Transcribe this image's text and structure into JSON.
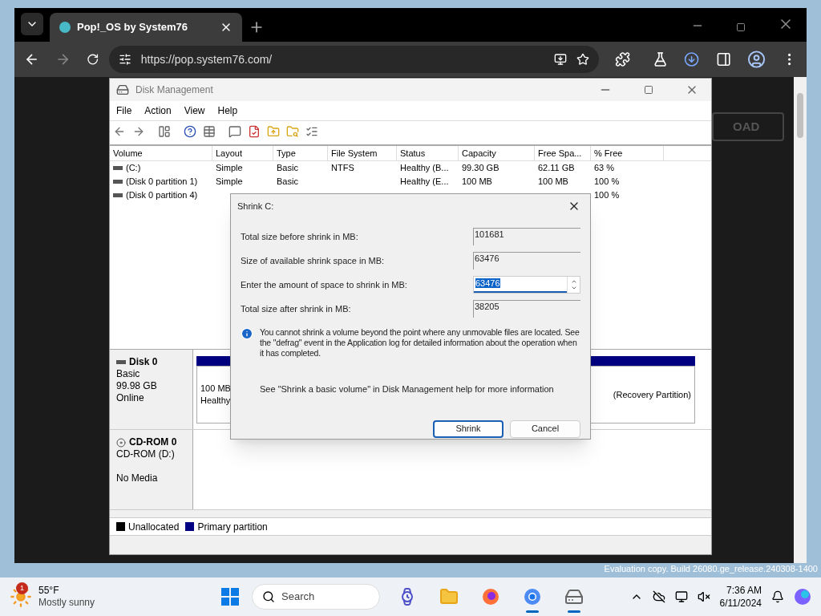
{
  "browser": {
    "tab": {
      "title": "Pop!_OS by System76",
      "selected": true
    },
    "url": "https://pop.system76.com/",
    "page_button": "OAD"
  },
  "disk_management": {
    "title": "Disk Management",
    "menu": [
      "File",
      "Action",
      "View",
      "Help"
    ],
    "columns": [
      "Volume",
      "Layout",
      "Type",
      "File System",
      "Status",
      "Capacity",
      "Free Spa...",
      "% Free"
    ],
    "rows": [
      [
        "(C:)",
        "Simple",
        "Basic",
        "NTFS",
        "Healthy (B...",
        "99.30 GB",
        "62.11 GB",
        "63 %"
      ],
      [
        "(Disk 0 partition 1)",
        "Simple",
        "Basic",
        null,
        "Healthy (E...",
        "100 MB",
        "100 MB",
        "100 %"
      ],
      [
        "(Disk 0 partition 4)",
        null,
        null,
        null,
        null,
        null,
        null,
        "100 %"
      ]
    ],
    "disks": [
      {
        "kind": "disk",
        "name": "Disk 0",
        "lines": [
          "Basic",
          "99.98 GB",
          "Online"
        ],
        "partitions": [
          {
            "lines": [
              "100 MB",
              "Healthy"
            ]
          },
          {
            "lines": [
              "(Recovery Partition)"
            ]
          }
        ]
      },
      {
        "kind": "cdrom",
        "name": "CD-ROM 0",
        "lines": [
          "CD-ROM (D:)",
          "No Media"
        ]
      }
    ],
    "legend": [
      {
        "label": "Unallocated",
        "color": "#000000"
      },
      {
        "label": "Primary partition",
        "color": "#000080"
      }
    ]
  },
  "dialog": {
    "title": "Shrink C:",
    "fields": [
      {
        "label": "Total size before shrink in MB:",
        "value": "101681",
        "kind": "readonly"
      },
      {
        "label": "Size of available shrink space in MB:",
        "value": "63476",
        "kind": "readonly"
      },
      {
        "label": "Enter the amount of space to shrink in MB:",
        "value": "63476",
        "kind": "spin"
      },
      {
        "label": "Total size after shrink in MB:",
        "value": "38205",
        "kind": "readonly"
      }
    ],
    "info": "You cannot shrink a volume beyond the point where any unmovable files are located. See the \"defrag\" event in the Application log for detailed information about the operation when it has completed.",
    "help": "See \"Shrink a basic volume\" in Disk Management help for more information",
    "buttons": [
      {
        "label": "Shrink",
        "default": true
      },
      {
        "label": "Cancel",
        "default": false
      }
    ]
  },
  "watermark": "Evaluation copy. Build 26080.ge_release.240308-1400",
  "taskbar": {
    "weather": {
      "badge": "1",
      "temp": "55°F",
      "condition": "Mostly sunny"
    },
    "search": "Search",
    "apps": [
      {
        "kind": "widgets",
        "running": false
      },
      {
        "kind": "files",
        "running": false
      },
      {
        "kind": "firefox",
        "running": false
      },
      {
        "kind": "chrome",
        "running": true
      },
      {
        "kind": "diskmgmt",
        "running": true
      }
    ],
    "time": "7:36 AM",
    "date": "6/11/2024"
  }
}
